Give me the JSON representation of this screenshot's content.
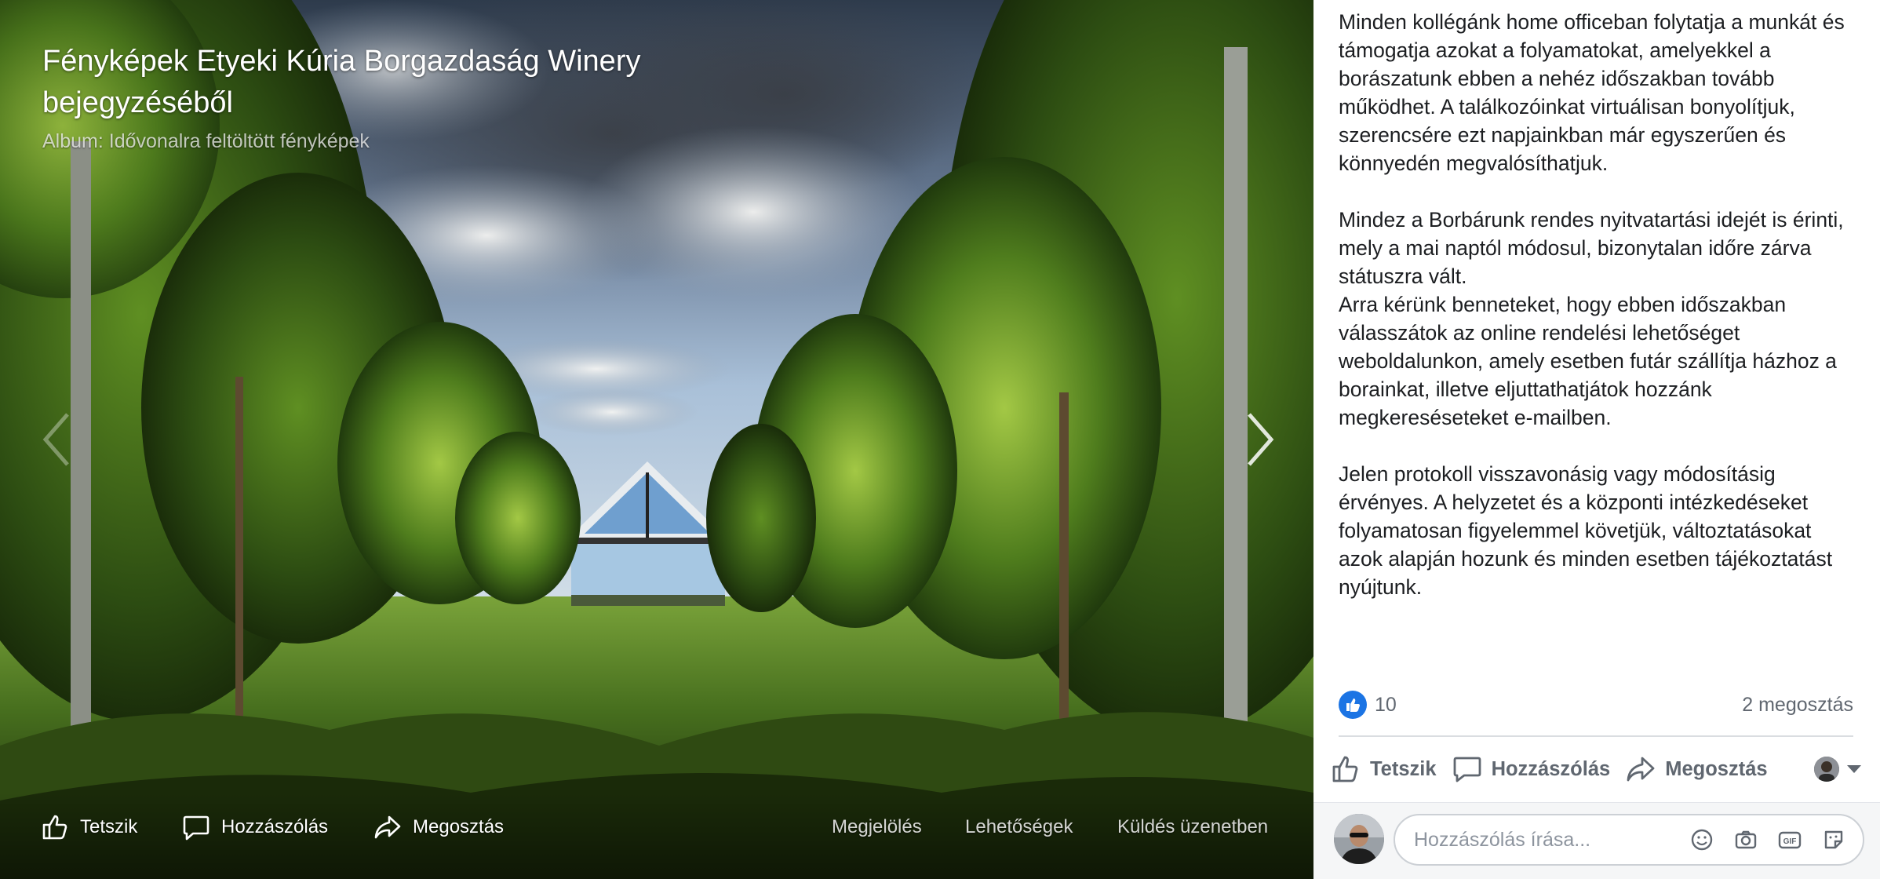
{
  "photo": {
    "title": "Fényképek Etyeki Kúria Borgazdaság Winery bejegyzéséből",
    "album": "Album: Idővonalra feltöltött fényképek",
    "prev_icon": "chevron-left-icon",
    "next_icon": "chevron-right-icon",
    "actions": {
      "like": "Tetszik",
      "comment": "Hozzászólás",
      "share": "Megosztás"
    },
    "links": {
      "tag": "Megjelölés",
      "options": "Lehetőségek",
      "send": "Küldés üzenetben"
    }
  },
  "post": {
    "paragraphs": [
      "Minden kollégánk home officeban folytatja a munkát és támogatja azokat a folyamatokat, amelyekkel a borászatunk ebben a nehéz időszakban tovább működhet. A találkozóinkat virtuálisan bonyolítjuk, szerencsére ezt napjainkban már egyszerűen és könnyedén megvalósíthatjuk.",
      "Mindez a Borbárunk rendes nyitvatartási idejét is érinti, mely a mai naptól módosul, bizonytalan időre zárva státuszra vált.\nArra kérünk benneteket, hogy ebben időszakban válasszátok az online rendelési lehetőséget weboldalunkon, amely esetben futár szállítja házhoz a borainkat, illetve eljuttathatjátok hozzánk megkereséseteket e-mailben.",
      "Jelen protokoll visszavonásig vagy módosításig érvényes. A helyzetet és a központi intézkedéseket folyamatosan figyelemmel követjük, változtatásokat azok alapján hozunk és minden esetben tájékoztatást nyújtunk."
    ],
    "reaction_count": "10",
    "share_count": "2 megosztás",
    "actions": {
      "like": "Tetszik",
      "comment": "Hozzászólás",
      "share": "Megosztás"
    },
    "comment_placeholder": "Hozzászólás írása...",
    "comment_icons": [
      "emoji-icon",
      "camera-icon",
      "gif-icon",
      "sticker-icon"
    ]
  },
  "colors": {
    "accent": "#1b74e4",
    "text": "#1c1e21",
    "muted": "#606770"
  }
}
